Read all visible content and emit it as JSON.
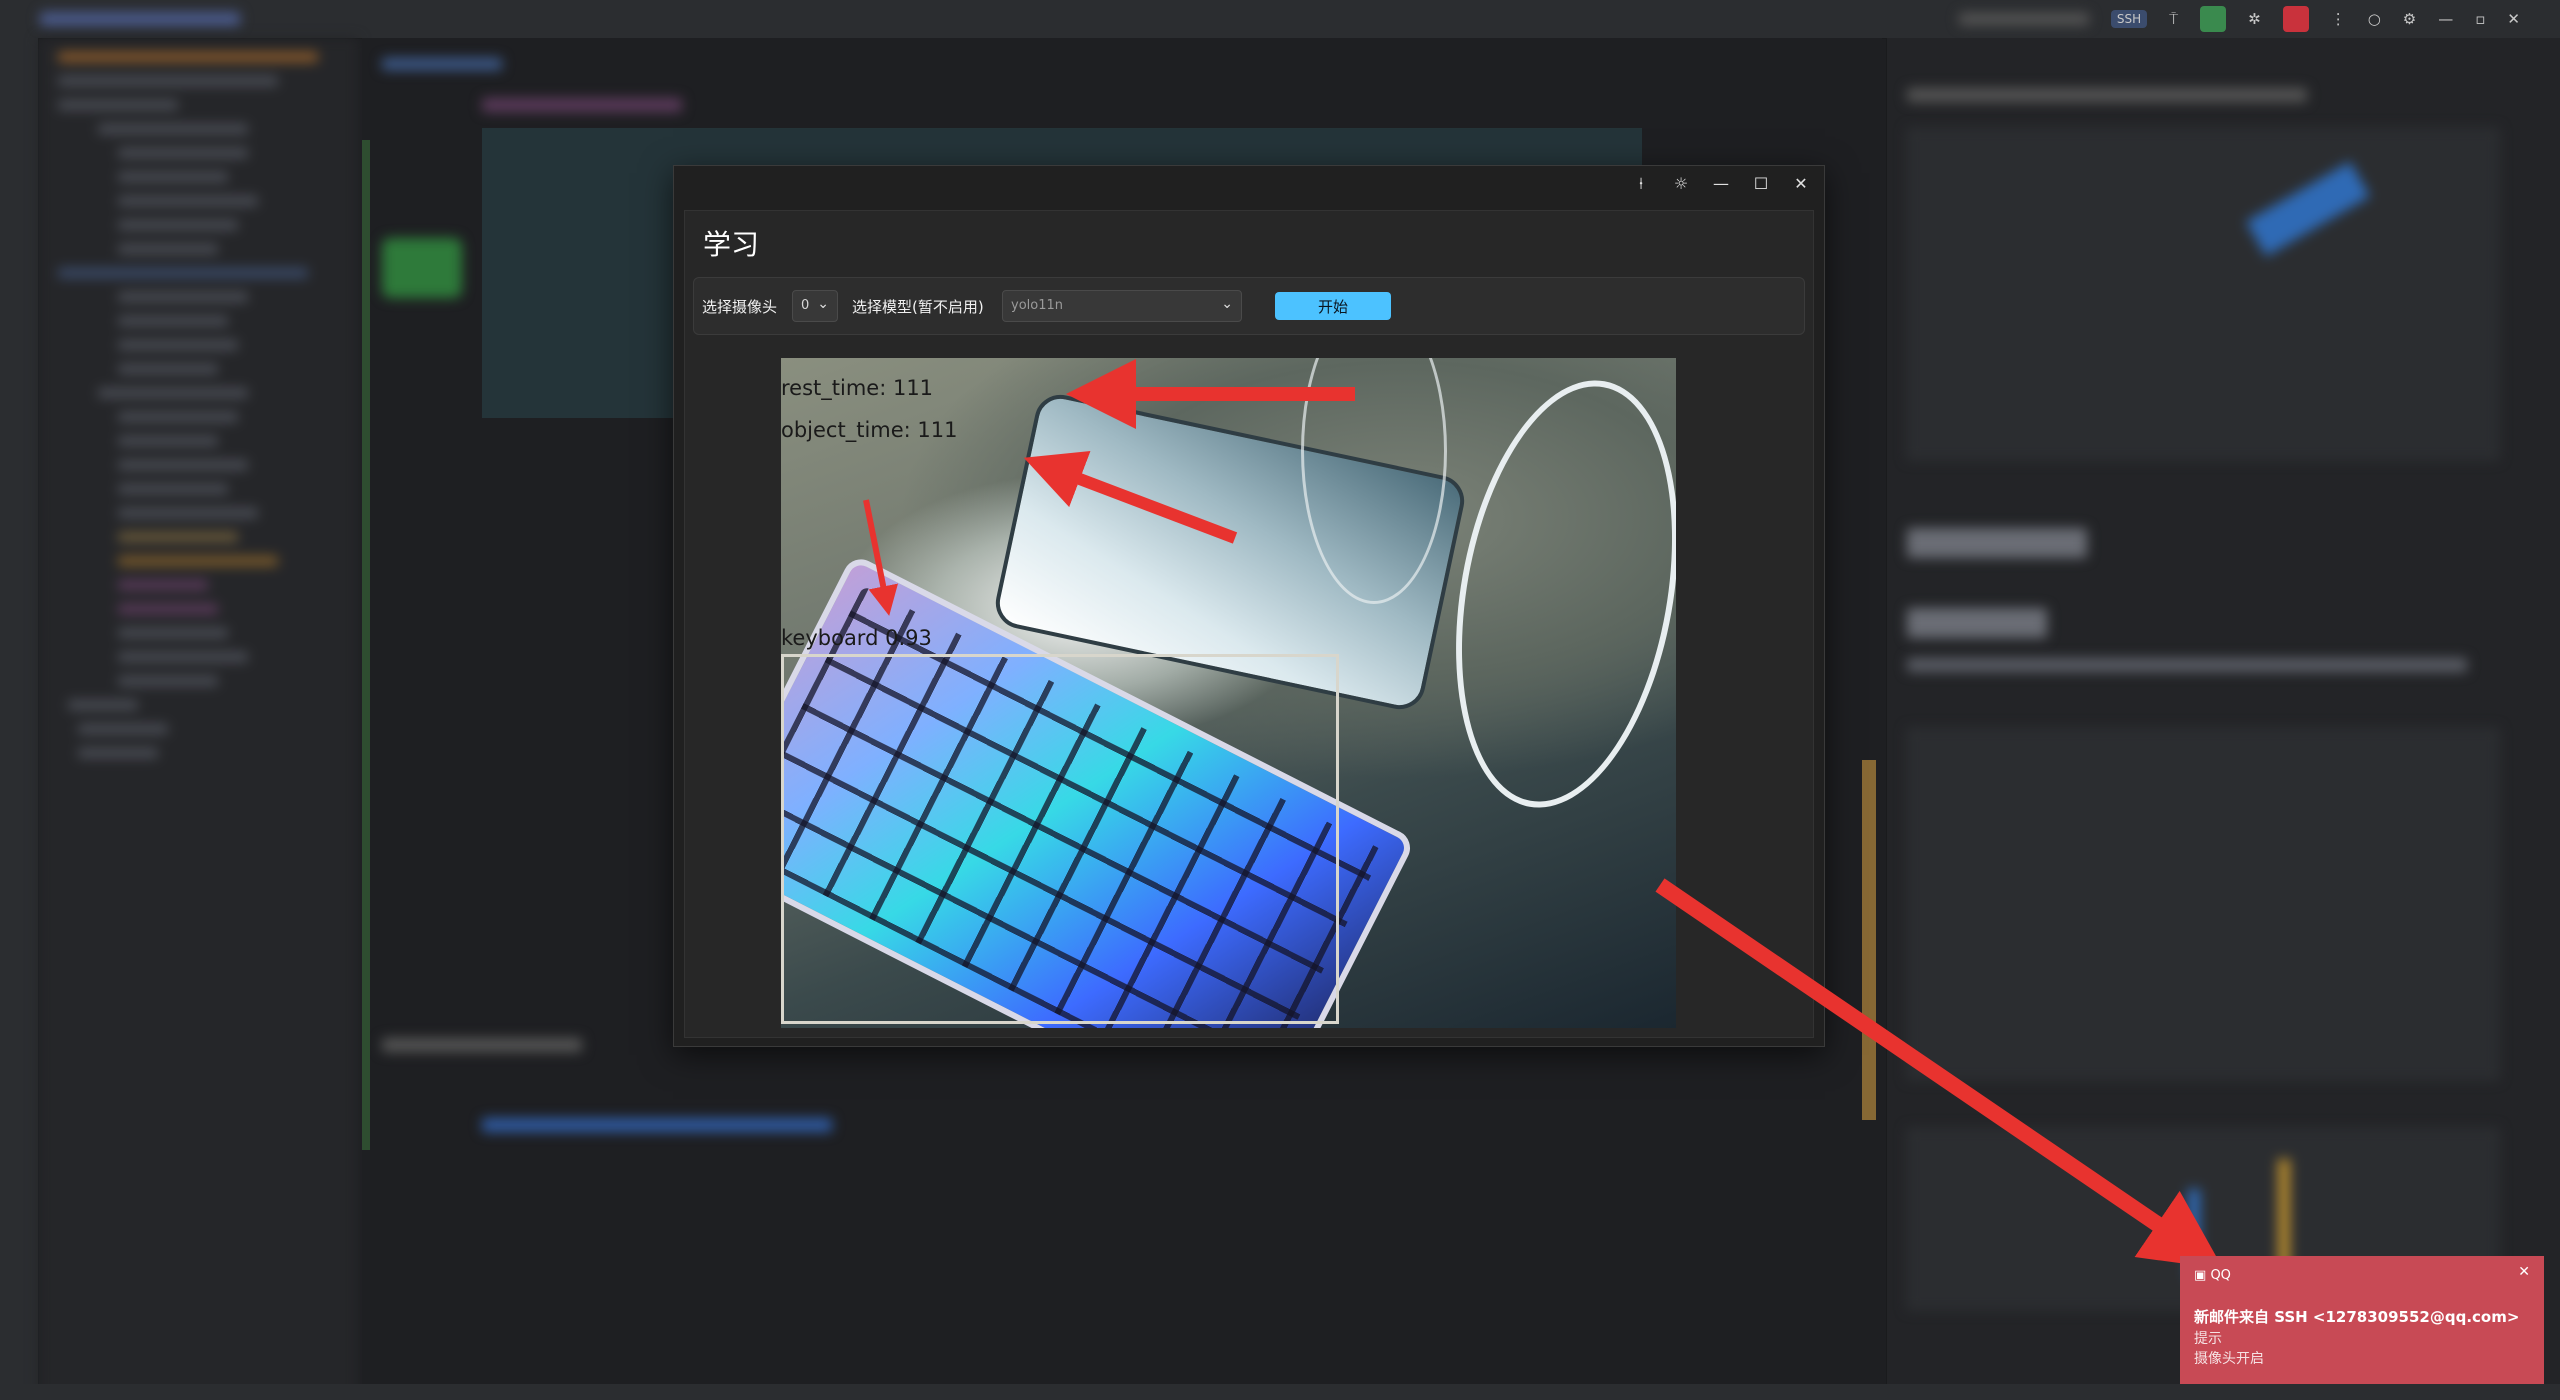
{
  "app_window": {
    "title": "学习",
    "controls": {
      "pin": "⍿",
      "settings": "☼",
      "minimize": "—",
      "maximize": "☐",
      "close": "✕"
    },
    "toolbar": {
      "camera_label": "选择摄像头",
      "camera_value": "0",
      "model_label": "选择模型(暂不启用)",
      "model_value": "yolo11n",
      "start_label": "开始"
    },
    "camera_view": {
      "overlays": {
        "rest_time": "rest_time:  111",
        "object_time": "object_time:  111",
        "detection_label": "keyboard  0.93"
      }
    }
  },
  "titlebar": {
    "ssh_label": "SSH"
  },
  "notification": {
    "app": "QQ",
    "close": "✕",
    "subject": "新邮件来自 SSH <1278309552@qq.com>",
    "line1": "提示",
    "line2": "摄像头开启"
  },
  "colors": {
    "accent_button": "#4cc2ff",
    "arrow": "#e8332f",
    "toast_bg": "#c84a55",
    "bbox": "#d8d6cc"
  }
}
